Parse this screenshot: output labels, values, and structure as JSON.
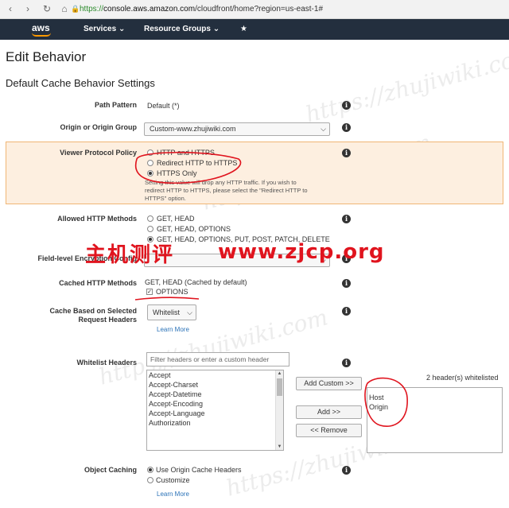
{
  "browser": {
    "url_scheme": "https://",
    "url_host": "console.aws.amazon.com",
    "url_rest": "/cloudfront/home?region=us-east-1#"
  },
  "awsnav": {
    "logo": "aws",
    "services": "Services",
    "resource_groups": "Resource Groups"
  },
  "page": {
    "title": "Edit Behavior",
    "section_title": "Default Cache Behavior Settings"
  },
  "path_pattern": {
    "label": "Path Pattern",
    "value": "Default (*)"
  },
  "origin": {
    "label": "Origin or Origin Group",
    "value": "Custom-www.zhujiwiki.com"
  },
  "viewer_protocol": {
    "label": "Viewer Protocol Policy",
    "options": [
      "HTTP and HTTPS",
      "Redirect HTTP to HTTPS",
      "HTTPS Only"
    ],
    "selected": "HTTPS Only",
    "note": "Setting this value will drop any HTTP traffic. If you wish to redirect HTTP to HTTPS, please select the \"Redirect HTTP to HTTPS\" option."
  },
  "allowed_methods": {
    "label": "Allowed HTTP Methods",
    "options": [
      "GET, HEAD",
      "GET, HEAD, OPTIONS",
      "GET, HEAD, OPTIONS, PUT, POST, PATCH, DELETE"
    ],
    "selected": "GET, HEAD, OPTIONS, PUT, POST, PATCH, DELETE"
  },
  "field_level": {
    "label": "Field-level Encryption Config"
  },
  "cached_methods": {
    "label": "Cached HTTP Methods",
    "default_text": "GET, HEAD (Cached by default)",
    "options_label": "OPTIONS",
    "options_checked": true
  },
  "cache_headers": {
    "label_line1": "Cache Based on Selected",
    "label_line2": "Request Headers",
    "value": "Whitelist",
    "learn_more": "Learn More"
  },
  "whitelist": {
    "label": "Whitelist Headers",
    "filter_placeholder": "Filter headers or enter a custom header",
    "add_custom": "Add Custom >>",
    "add": "Add >>",
    "remove": "<< Remove",
    "count_text": "2 header(s) whitelisted",
    "available": [
      "Accept",
      "Accept-Charset",
      "Accept-Datetime",
      "Accept-Encoding",
      "Accept-Language",
      "Authorization"
    ],
    "selected": [
      "Host",
      "Origin"
    ]
  },
  "object_caching": {
    "label": "Object Caching",
    "options": [
      "Use Origin Cache Headers",
      "Customize"
    ],
    "selected": "Use Origin Cache Headers",
    "learn_more": "Learn More"
  },
  "watermark": {
    "cn": "主机测评",
    "url": "www.zjcp.org",
    "bg": "https://zhujiwiki.com"
  },
  "colors": {
    "aws_nav": "#232f3e",
    "aws_orange": "#ff9900",
    "warning_bg": "#fdefe0",
    "annotation_red": "#e0141e",
    "link": "#2c73b8"
  }
}
